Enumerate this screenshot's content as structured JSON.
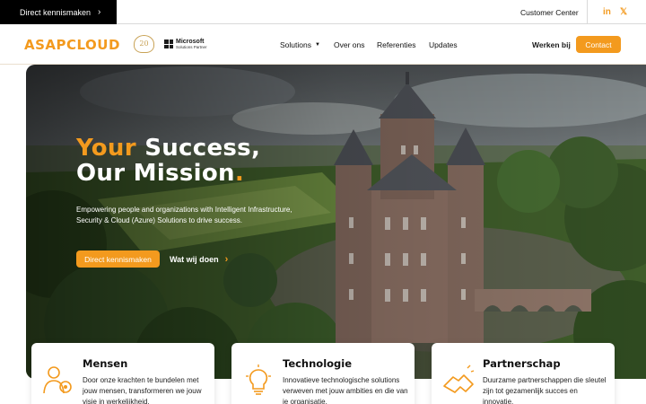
{
  "topbar": {
    "cta_label": "Direct kennismaken",
    "customer_center": "Customer Center",
    "linkedin": "in",
    "x": "𝕏"
  },
  "nav": {
    "logo": "ASAPCLOUD",
    "anniversary": "20",
    "partner_name": "Microsoft",
    "partner_sub": "Solutions Partner",
    "items": [
      "Solutions",
      "Over ons",
      "Referenties",
      "Updates"
    ],
    "werken": "Werken bij",
    "contact": "Contact"
  },
  "hero": {
    "headline_1a": "Your",
    "headline_1b": "Success,",
    "headline_2a": "Our Mission",
    "headline_2b": ".",
    "subtext": "Empowering people and organizations with Intelligent Infrastructure, Security & Cloud (Azure) Solutions to drive success.",
    "primary_cta": "Direct kennismaken",
    "secondary_cta": "Wat wij doen"
  },
  "cards": [
    {
      "title": "Mensen",
      "text": "Door onze krachten te bundelen met jouw mensen, transformeren we jouw visie in werkelijkheid.",
      "icon": "people-icon"
    },
    {
      "title": "Technologie",
      "text": "Innovatieve technologische solutions verweven met jouw ambities en die van je organisatie.",
      "icon": "lightbulb-icon"
    },
    {
      "title": "Partnerschap",
      "text": "Duurzame partnerschappen die sleutel zijn tot gezamenlijk succes en innovatie.",
      "icon": "handshake-icon"
    }
  ],
  "colors": {
    "accent": "#f39a1e",
    "dark": "#000000"
  }
}
